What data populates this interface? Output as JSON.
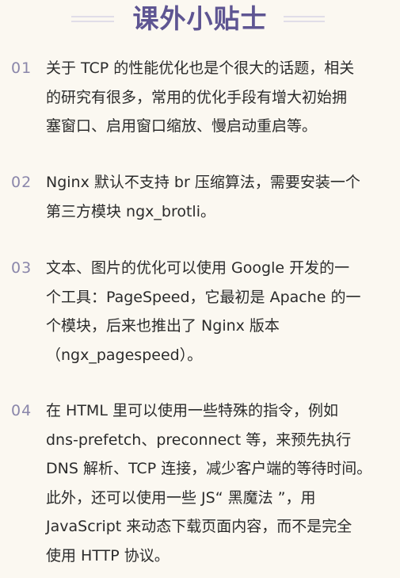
{
  "header": {
    "title": "课外小贴士"
  },
  "tips": [
    {
      "number": "01",
      "text": "关于 TCP 的性能优化也是个很大的话题，相关\n的研究有很多，常用的优化手段有增大初始拥\n塞窗口、启用窗口缩放、慢启动重启等。"
    },
    {
      "number": "02",
      "text": "Nginx 默认不支持 br 压缩算法，需要安装一个\n第三方模块 ngx_brotli。"
    },
    {
      "number": "03",
      "text": "文本、图片的优化可以使用 Google 开发的一\n个工具：PageSpeed，它最初是 Apache 的一\n个模块，后来也推出了 Nginx 版本\n（ngx_pagespeed）。"
    },
    {
      "number": "04",
      "text": "在 HTML 里可以使用一些特殊的指令，例如\ndns-prefetch、preconnect 等，来预先执行\nDNS 解析、TCP 连接，减少客户端的等待时间。\n此外，还可以使用一些 JS“ 黑魔法 ”，用\nJavaScript 来动态下载页面内容，而不是完全\n使用 HTTP 协议。"
    }
  ],
  "colors": {
    "title": "#5e5592",
    "number": "#8a86aa",
    "text": "#2b2b2b",
    "background": "#fbf8f1"
  }
}
